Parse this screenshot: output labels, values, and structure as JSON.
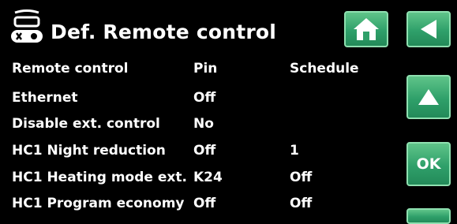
{
  "header": {
    "title": "Def. Remote control",
    "icon": "remote-control-icon"
  },
  "nav": {
    "home_icon": "home-icon",
    "back_icon": "back-arrow-icon",
    "up_icon": "up-arrow-icon",
    "ok_label": "OK"
  },
  "table": {
    "rows": [
      {
        "label": "Remote control",
        "pin": "Pin",
        "schedule": "Schedule"
      },
      {
        "label": "Ethernet",
        "pin": "Off",
        "schedule": ""
      },
      {
        "label": "Disable ext. control",
        "pin": "No",
        "schedule": ""
      },
      {
        "label": "HC1 Night reduction",
        "pin": "Off",
        "schedule": "1"
      },
      {
        "label": "HC1 Heating mode ext.",
        "pin": "K24",
        "schedule": "Off"
      },
      {
        "label": "HC1 Program economy",
        "pin": "Off",
        "schedule": "Off"
      }
    ]
  },
  "colors": {
    "background": "#000000",
    "button": "#2fa06a",
    "text": "#ffffff"
  }
}
